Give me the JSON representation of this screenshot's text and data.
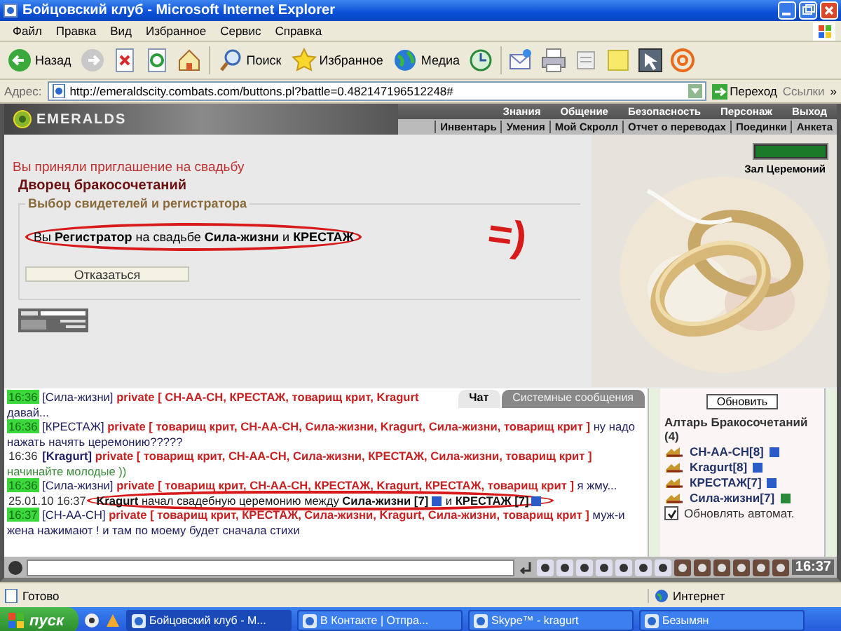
{
  "window": {
    "title": "Бойцовский клуб - Microsoft Internet Explorer"
  },
  "menu": [
    "Файл",
    "Правка",
    "Вид",
    "Избранное",
    "Сервис",
    "Справка"
  ],
  "toolbar": [
    {
      "kind": "back",
      "label": "Назад"
    },
    {
      "kind": "forward"
    },
    {
      "kind": "stop"
    },
    {
      "kind": "refresh"
    },
    {
      "kind": "home"
    },
    {
      "kind": "search",
      "label": "Поиск"
    },
    {
      "kind": "favorites",
      "label": "Избранное"
    },
    {
      "kind": "media",
      "label": "Медиа"
    },
    {
      "kind": "history"
    },
    {
      "kind": "mail"
    },
    {
      "kind": "print"
    },
    {
      "kind": "edit"
    },
    {
      "kind": "note"
    },
    {
      "kind": "app"
    },
    {
      "kind": "at"
    }
  ],
  "address": {
    "label": "Адрес:",
    "url": "http://emeraldscity.combats.com/buttons.pl?battle=0.482147196512248#",
    "go": "Переход",
    "links": "Ссылки",
    "more": "»"
  },
  "game": {
    "logo": "EMERALDS",
    "nav_top": [
      "Знания",
      "Общение",
      "Безопасность",
      "Персонаж",
      "Выход"
    ],
    "nav_bottom": [
      "Инвентарь",
      "Умения",
      "Мой Скролл",
      "Отчет о переводах",
      "Поединки",
      "Анкета"
    ],
    "health": {
      "level": 1
    },
    "location_link": "Зал Церемоний",
    "notice": "Вы приняли приглашение на свадьбу",
    "heading": "Дворец бракосочетаний",
    "fieldset_legend": "Выбор свидетелей и регистратора",
    "sentence": "Вы **Регистратор** на свадьбе **Сила-жизни** и **КРЕСТАЖ**",
    "sentence_circled": true,
    "refuse_button": "Отказаться",
    "annotation": "=)"
  },
  "chat": {
    "tabs": [
      {
        "label": "Чат",
        "selected": true
      },
      {
        "label": "Системные сообщения",
        "selected": false
      }
    ],
    "messages": [
      {
        "kind": "private",
        "time": "16:36",
        "highlighted": true,
        "nick": "[Сила-жизни]",
        "nick_bold": false,
        "recipients": "private [ СН-АА-СН, КРЕСТАЖ, товарищ крит, Kragurt",
        "text": "давай...",
        "color": "#202060"
      },
      {
        "kind": "private",
        "time": "16:36",
        "highlighted": true,
        "nick": "[КРЕСТАЖ]",
        "nick_bold": false,
        "recipients": "private [ товарищ крит, СН-АА-СН, Сила-жизни, Kragurt, Сила-жизни, товарищ крит ]",
        "text": "ну надо нажать начять церемонию?????",
        "color": "#202060"
      },
      {
        "kind": "private",
        "time": "16:36",
        "highlighted": false,
        "nick": "[Kragurt]",
        "nick_bold": true,
        "recipients": "private [ товарищ крит, СН-АА-СН, Сила-жизни, КРЕСТАЖ, Сила-жизни, товарищ крит ]",
        "text": "начинайте молодые ))",
        "color": "#3a8a3a"
      },
      {
        "kind": "private",
        "time": "16:36",
        "highlighted": true,
        "nick": "[Сила-жизни]",
        "nick_bold": false,
        "recipients": "private [ товарищ крит, СН-АА-СН, КРЕСТАЖ, Kragurt, КРЕСТАЖ, товарищ крит ]",
        "text": "я жму...",
        "color": "#202060"
      },
      {
        "kind": "system",
        "time": "25.01.10 16:37",
        "circled": true,
        "parts": [
          {
            "text": "Kragurt",
            "bold": true
          },
          {
            "text": "начал свадебную церемонию между",
            "bold": false
          },
          {
            "text": "Сила-жизни [7]",
            "bold": true,
            "color": "#2a5bc8"
          },
          {
            "text": "и",
            "bold": false
          },
          {
            "text": "КРЕСТАЖ [7]",
            "bold": true,
            "color": "#2a5bc8"
          }
        ]
      },
      {
        "kind": "private",
        "time": "16:37",
        "highlighted": true,
        "nick": "[СН-АА-СН]",
        "nick_bold": false,
        "recipients": "private [ товарищ крит, КРЕСТАЖ, Сила-жизни, Kragurt, Сила-жизни, товарищ крит ]",
        "text": "муж-и жена нажимают ! и там по моему будет сначала стихи",
        "color": "#202060"
      }
    ]
  },
  "side": {
    "refresh_button": "Обновить",
    "room": "Алтарь Бракосочетаний",
    "count": "(4)",
    "users": [
      {
        "name": "СН-АА-СН",
        "level": "[8]",
        "color": "#2a5bc8"
      },
      {
        "name": "Kragurt",
        "level": "[8]",
        "color": "#2a5bc8"
      },
      {
        "name": "КРЕСТАЖ",
        "level": "[7]",
        "color": "#2a5bc8"
      },
      {
        "name": "Сила-жизни",
        "level": "[7]",
        "color": "#2a8a3a"
      }
    ],
    "auto_refresh": {
      "label": "Обновлять автомат.",
      "checked": true
    }
  },
  "chat_toolbar": {
    "clock": "16:37"
  },
  "status_bar": {
    "text": "Готово",
    "zone": "Интернет"
  },
  "taskbar": {
    "start": "пуск",
    "tasks": [
      {
        "label": "Бойцовский клуб - М...",
        "selected": true
      },
      {
        "label": "В Контакте | Отпра...",
        "selected": false
      },
      {
        "label": "Skype™ - kragurt",
        "selected": false
      },
      {
        "label": "Безымян",
        "selected": false
      }
    ]
  }
}
